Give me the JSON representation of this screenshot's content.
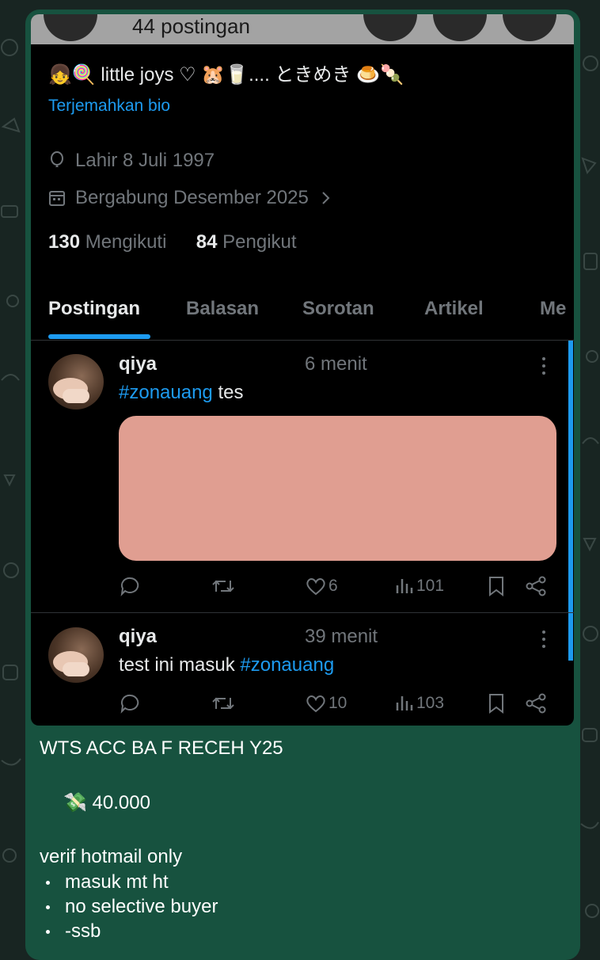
{
  "profile": {
    "post_count": "44 postingan",
    "bio": "👧🍭 little joys ♡ 🐹🥛.... ときめき 🍮🍡",
    "translate_link": "Terjemahkan bio",
    "birthdate": "Lahir 8 Juli 1997",
    "joined": "Bergabung Desember 2025",
    "following_count": "130",
    "following_label": "Mengikuti",
    "followers_count": "84",
    "followers_label": "Pengikut"
  },
  "tabs": [
    "Postingan",
    "Balasan",
    "Sorotan",
    "Artikel",
    "Me"
  ],
  "posts": [
    {
      "username": "qiya",
      "time": "6 menit",
      "hashtag": "#zonauang",
      "text": " tes",
      "likes": "6",
      "views": "101"
    },
    {
      "username": "qiya",
      "time": "39 menit",
      "text": "test ini masuk ",
      "hashtag": "#zonauang",
      "likes": "10",
      "views": "103"
    }
  ],
  "message": {
    "title": "WTS ACC BA F RECEH Y25",
    "price_emoji": "💸",
    "price": " 40.000",
    "note": "verif hotmail only",
    "bullets": [
      "masuk mt ht",
      "no selective buyer",
      "-ssb"
    ]
  },
  "colors": {
    "chat_background": "#182522",
    "bubble": "#17523f",
    "accent": "#1d9bf0",
    "media_placeholder": "#e09e91"
  }
}
